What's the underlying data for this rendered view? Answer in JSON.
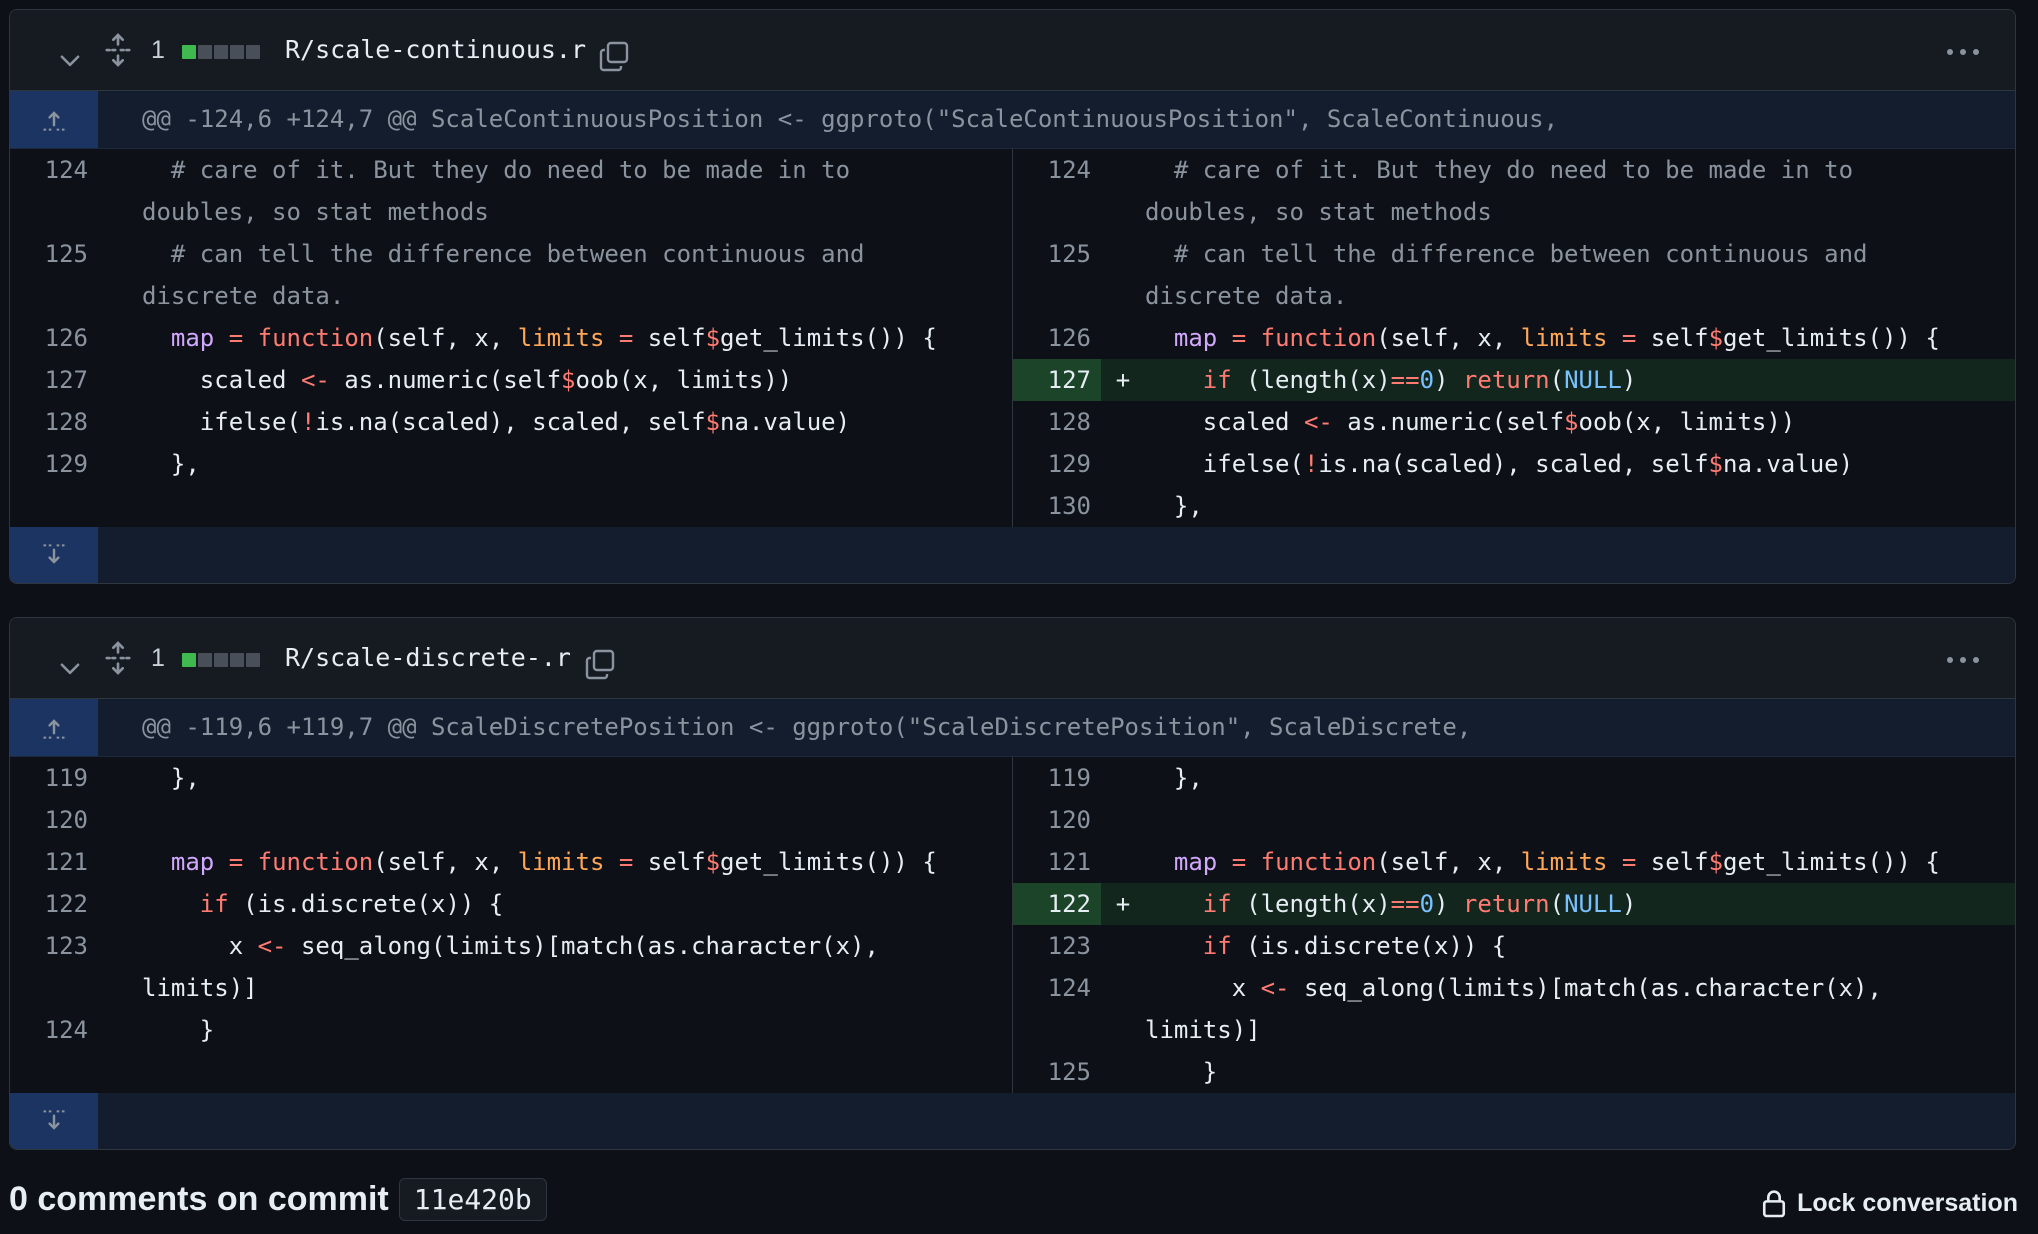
{
  "files": [
    {
      "change_count": "1",
      "path": "R/scale-continuous.r",
      "hunk": "@@ -124,6 +124,7 @@ ScaleContinuousPosition <- ggproto(\"ScaleContinuousPosition\", ScaleContinuous,",
      "left": [
        "124",
        "125",
        "126",
        "127",
        "128",
        "129"
      ],
      "right": [
        "124",
        "125",
        "126",
        "127",
        "128",
        "129",
        "130"
      ]
    },
    {
      "change_count": "1",
      "path": "R/scale-discrete-.r",
      "hunk": "@@ -119,6 +119,7 @@ ScaleDiscretePosition <- ggproto(\"ScaleDiscretePosition\", ScaleDiscrete,",
      "left": [
        "119",
        "120",
        "121",
        "122",
        "123",
        "124"
      ],
      "right": [
        "119",
        "120",
        "121",
        "122",
        "123",
        "124",
        "125"
      ]
    }
  ],
  "added_marker": "+",
  "footer": {
    "title": "0 comments on commit",
    "sha": "11e420b",
    "lock_label": "Lock conversation"
  },
  "colors": {
    "background": "#0d1117",
    "header": "#161b22",
    "hunk_bg": "#131d2e",
    "hunk_gutter": "#1c3461",
    "added_bg": "#12261e",
    "added_gutter": "#1c4428",
    "diffstat_added": "#3fb950",
    "diffstat_neutral": "#484f58"
  }
}
